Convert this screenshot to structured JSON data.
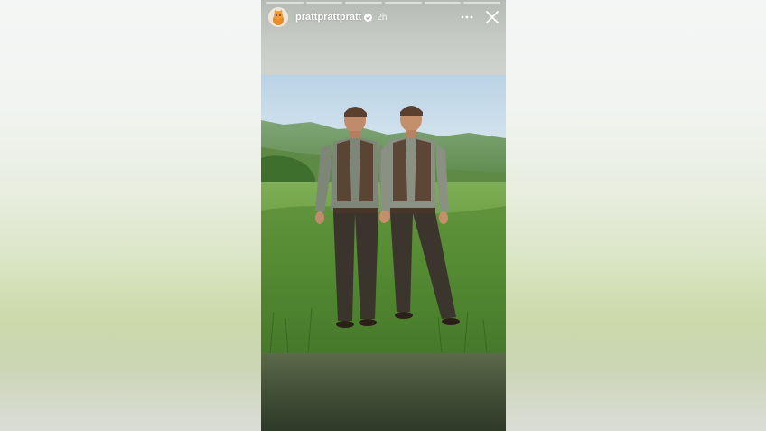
{
  "backdrop": {
    "style": "blurred-photo"
  },
  "story": {
    "progress_segments": 6,
    "progress_active_index": 0,
    "header": {
      "avatar_icon": "orange-cat-avatar-icon",
      "username": "prattprattpratt",
      "verified_icon": "verified-badge-icon",
      "timestamp": "2h"
    },
    "controls": {
      "more_icon": "more-options-icon",
      "close_icon": "close-icon"
    },
    "media": {
      "kind": "photo",
      "subject": "two-men-in-khaki-shirts-and-vests-on-grassy-hill"
    }
  },
  "colors": {
    "overlay_text": "#ffffff",
    "grass": "#5f8f3a",
    "sky": "#eef3f6",
    "mountain": "#6f9a5e"
  }
}
